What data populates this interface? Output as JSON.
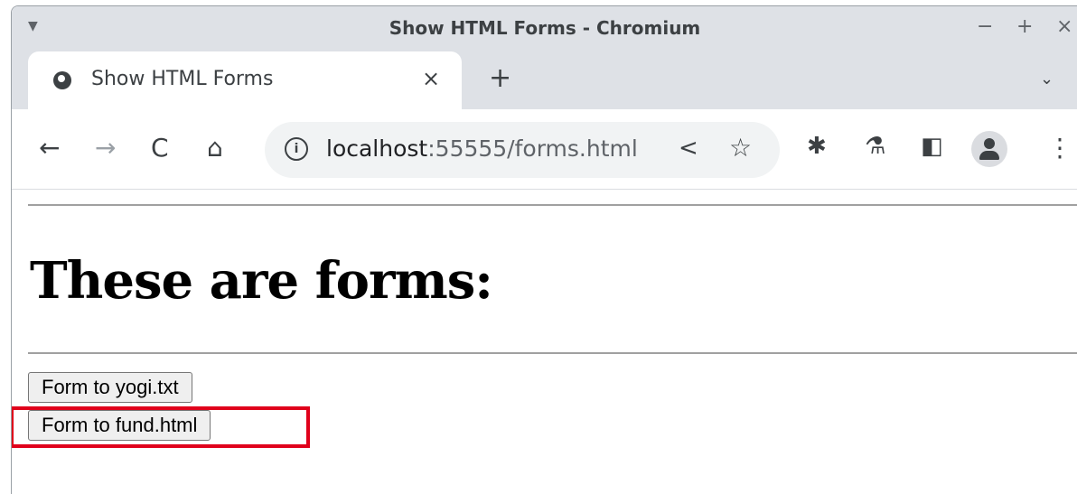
{
  "window": {
    "title": "Show HTML Forms - Chromium",
    "menu_icon": "triangle-down-icon",
    "controls": {
      "minimize": "−",
      "maximize": "+",
      "close": "×"
    }
  },
  "tab": {
    "title": "Show HTML Forms",
    "close_glyph": "×",
    "new_tab_glyph": "+",
    "search_glyph": "⌄"
  },
  "toolbar": {
    "back": "←",
    "forward": "→",
    "reload": "C",
    "home": "⌂",
    "url_host": "localhost",
    "url_rest": ":55555/forms.html",
    "share": "<",
    "bookmark": "☆",
    "extensions": "✱",
    "labs": "⚗",
    "side_panel": "◧",
    "menu": "⋮"
  },
  "page": {
    "heading": "These are forms:",
    "buttons": [
      "Form to yogi.txt",
      "Form to fund.html"
    ],
    "highlight_color": "#e0001b"
  }
}
